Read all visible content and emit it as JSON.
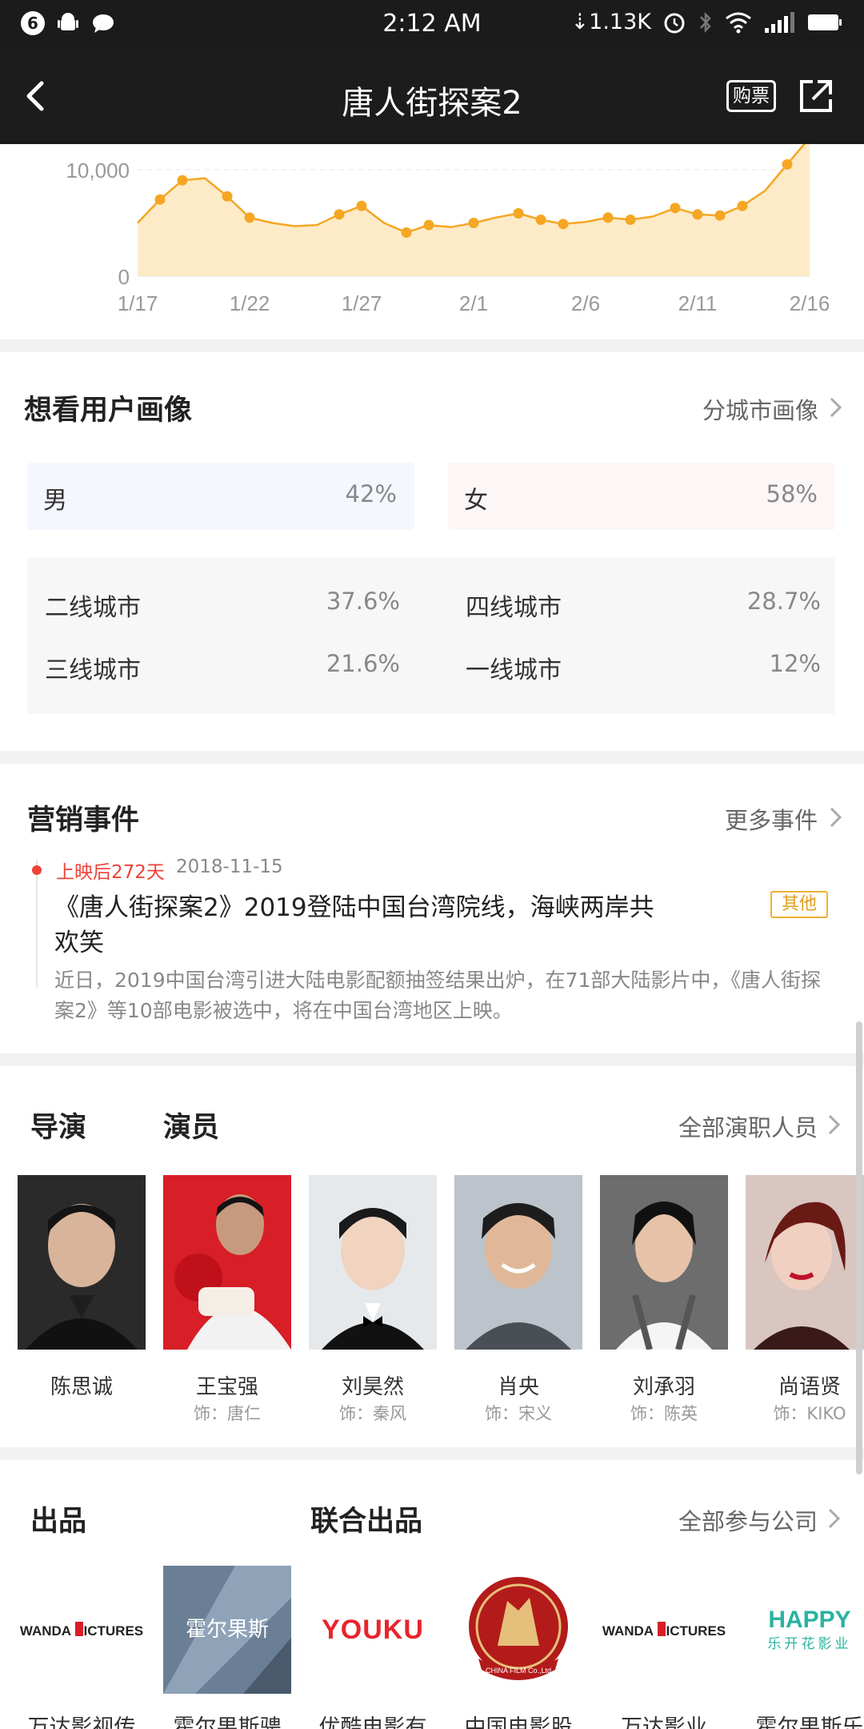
{
  "status_bar": {
    "notification_count": "6",
    "time": "2:12 AM",
    "net_speed": "⇣1.13K"
  },
  "header": {
    "title": "唐人街探案2",
    "ticket_label": "购票"
  },
  "chart_data": {
    "type": "area",
    "x_ticks": [
      "1/17",
      "1/22",
      "1/27",
      "2/1",
      "2/6",
      "2/11",
      "2/16"
    ],
    "y_ticks": [
      "10,000",
      "0"
    ],
    "x": [
      "1/17",
      "1/18",
      "1/19",
      "1/20",
      "1/21",
      "1/22",
      "1/23",
      "1/24",
      "1/25",
      "1/26",
      "1/27",
      "1/28",
      "1/29",
      "1/30",
      "1/31",
      "2/1",
      "2/2",
      "2/3",
      "2/4",
      "2/5",
      "2/6",
      "2/7",
      "2/8",
      "2/9",
      "2/10",
      "2/11",
      "2/12",
      "2/13",
      "2/14",
      "2/15",
      "2/16"
    ],
    "values": [
      5000,
      7200,
      9000,
      9200,
      7500,
      5500,
      5000,
      4700,
      4800,
      5800,
      6600,
      5000,
      4100,
      4800,
      4600,
      5000,
      5500,
      5900,
      5300,
      4900,
      5100,
      5500,
      5300,
      5600,
      6400,
      5800,
      5700,
      6600,
      8000,
      10500,
      13000
    ],
    "marked_points": [
      1,
      2,
      4,
      5,
      9,
      10,
      12,
      13,
      15,
      17,
      18,
      19,
      21,
      22,
      24,
      25,
      26,
      27,
      29
    ],
    "ylim": [
      0,
      10000
    ],
    "grid": true,
    "color": "#f5a623"
  },
  "portrait": {
    "title": "想看用户画像",
    "more": "分城市画像",
    "male_label": "男",
    "male_value": "42%",
    "female_label": "女",
    "female_value": "58%",
    "cities": [
      {
        "label": "二线城市",
        "value": "37.6%"
      },
      {
        "label": "四线城市",
        "value": "28.7%"
      },
      {
        "label": "三线城市",
        "value": "21.6%"
      },
      {
        "label": "一线城市",
        "value": "12%"
      }
    ]
  },
  "marketing": {
    "title": "营销事件",
    "more": "更多事件",
    "event_tag": "上映后272天",
    "event_date": "2018-11-15",
    "event_title": "《唐人街探案2》2019登陆中国台湾院线，海峡两岸共欢笑",
    "event_badge": "其他",
    "event_desc": "近日，2019中国台湾引进大陆电影配额抽签结果出炉，在71部大陆影片中，《唐人街探案2》等10部电影被选中，将在中国台湾地区上映。"
  },
  "cast": {
    "director_tab": "导演",
    "actor_tab": "演员",
    "more": "全部演职人员",
    "people": [
      {
        "name": "陈思诚",
        "role": ""
      },
      {
        "name": "王宝强",
        "role": "饰：唐仁"
      },
      {
        "name": "刘昊然",
        "role": "饰：秦风"
      },
      {
        "name": "肖央",
        "role": "饰：宋义"
      },
      {
        "name": "刘承羽",
        "role": "饰：陈英"
      },
      {
        "name": "尚语贤",
        "role": "饰：KIKO"
      }
    ]
  },
  "companies": {
    "produce_tab": "出品",
    "coproduce_tab": "联合出品",
    "more": "全部参与公司",
    "logo_wanda_1": "WANDA PICTURES",
    "logo_huoer": "霍尔果斯",
    "logo_youku": "YOUKU",
    "logo_china_film": "CHINA FILM Co.,Ltd",
    "logo_wanda_2": "WANDA PICTURES",
    "logo_happy": "HAPPY",
    "logo_happy_sub": "乐开花影业",
    "items": [
      {
        "name": "万达影视传"
      },
      {
        "name": "霍尔果斯骋"
      },
      {
        "name": "优酷电影有"
      },
      {
        "name": "中国电影股"
      },
      {
        "name": "万达影业"
      },
      {
        "name": "霍尔果斯乐"
      }
    ]
  }
}
